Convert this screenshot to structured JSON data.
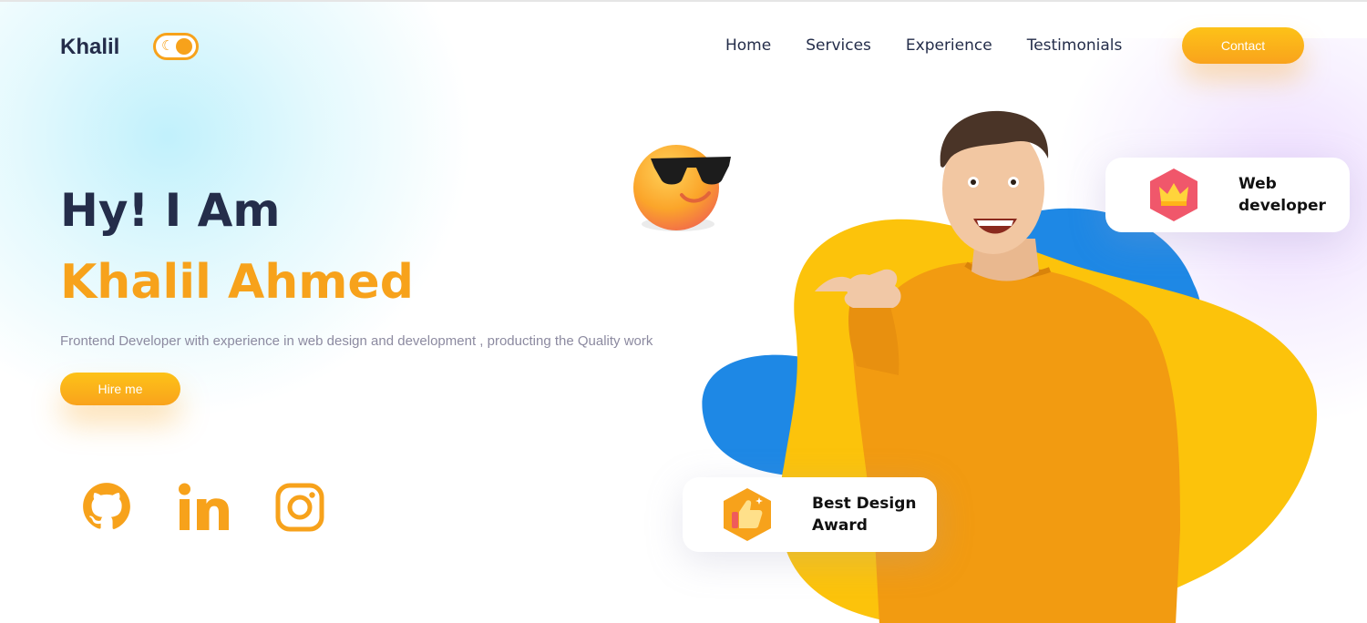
{
  "header": {
    "logo": "Khalil",
    "nav": [
      "Home",
      "Services",
      "Experience",
      "Testimonials"
    ],
    "contact_label": "Contact"
  },
  "hero": {
    "greeting": "Hy! I Am",
    "name": "Khalil Ahmed",
    "description": "Frontend Developer with experience in web design and development , producting the Quality work",
    "hire_label": "Hire me"
  },
  "social": [
    "github-icon",
    "linkedin-icon",
    "instagram-icon"
  ],
  "badges": {
    "web": "Web developer",
    "award": "Best Design Award"
  },
  "colors": {
    "accent": "#f7a21b",
    "dark": "#242d4a",
    "blob_yellow": "#fcc30b",
    "blob_blue": "#1e88e5"
  }
}
